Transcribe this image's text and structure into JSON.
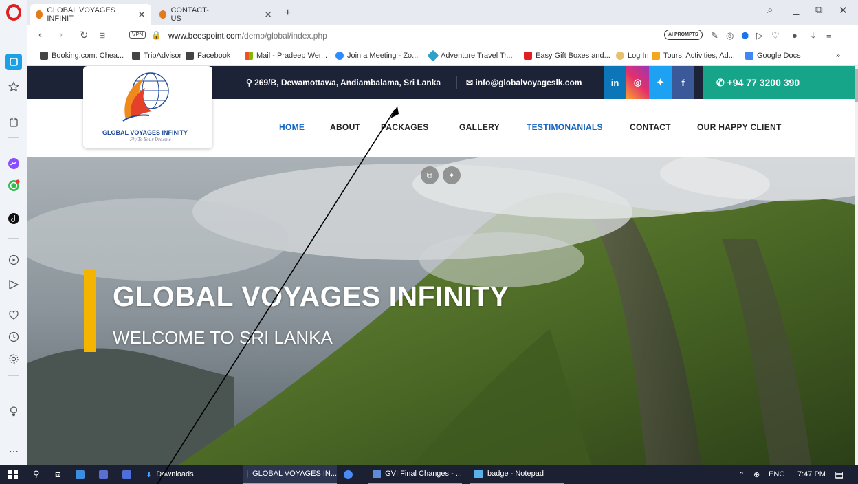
{
  "browser": {
    "tabs": [
      {
        "label": "GLOBAL VOYAGES INFINIT",
        "active": true
      },
      {
        "label": "CONTACT-US",
        "active": false
      }
    ],
    "new_tab": "+",
    "url_host": "www.beespoint.com",
    "url_path": "/demo/global/index.php",
    "vpn_label": "VPN",
    "ai_prompts_label": "AI PROMPTS",
    "bookmarks": [
      "Booking.com: Chea...",
      "TripAdvisor",
      "Facebook",
      "Mail - Pradeep Wer...",
      "Join a Meeting - Zo...",
      "Adventure Travel Tr...",
      "Easy Gift Boxes and...",
      "Log In",
      "Tours, Activities, Ad...",
      "Google Docs"
    ],
    "more_bookmarks": "»"
  },
  "site": {
    "address": "269/B, Dewamottawa, Andiambalama, Sri Lanka",
    "email": "info@globalvoyageslk.com",
    "social": [
      "in",
      "ig",
      "tw",
      "f"
    ],
    "phone": "+94 77 3200 390",
    "logo_text": "GLOBAL VOYAGES INFINITY",
    "logo_tagline": "Fly To Your Dreams",
    "menu": [
      "HOME",
      "ABOUT",
      "PACKAGES",
      "GALLERY",
      "TESTIMONANIALS",
      "CONTACT",
      "OUR HAPPY CLIENT"
    ],
    "hero_title": "GLOBAL VOYAGES INFINITY",
    "hero_subtitle": "WELCOME TO SRI LANKA",
    "colors": {
      "accent": "#f5b400",
      "topbar": "#1d2336",
      "phone_bg": "#16a589",
      "active_menu": "#1565c0"
    }
  },
  "taskbar": {
    "items": [
      {
        "label": "Downloads"
      },
      {
        "label": "GLOBAL VOYAGES IN..."
      },
      {
        "label": "GVI Final Changes - ..."
      },
      {
        "label": "badge - Notepad"
      }
    ],
    "language": "ENG",
    "time": "7:47 PM"
  }
}
